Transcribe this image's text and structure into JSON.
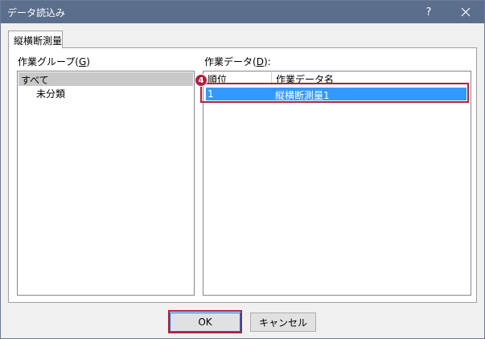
{
  "window": {
    "title": "データ読込み",
    "help_label": "?"
  },
  "tab": {
    "label": "縦横断測量"
  },
  "group_section": {
    "label": "作業グループ(",
    "mnemonic": "G",
    "label_end": ")",
    "items": [
      {
        "label": "すべて"
      },
      {
        "label": "未分類"
      }
    ]
  },
  "data_section": {
    "label": "作業データ(",
    "mnemonic": "D",
    "label_end": "):",
    "columns": [
      "順位",
      "作業データ名"
    ],
    "rows": [
      {
        "order": "1",
        "name": "縦横断測量1"
      }
    ]
  },
  "annotation": {
    "step_number": "4",
    "accent_color": "#b02040"
  },
  "buttons": {
    "ok": "OK",
    "cancel": "キャンセル"
  },
  "colors": {
    "titlebar": "#5b6f8c",
    "selection": "#3399ff"
  }
}
